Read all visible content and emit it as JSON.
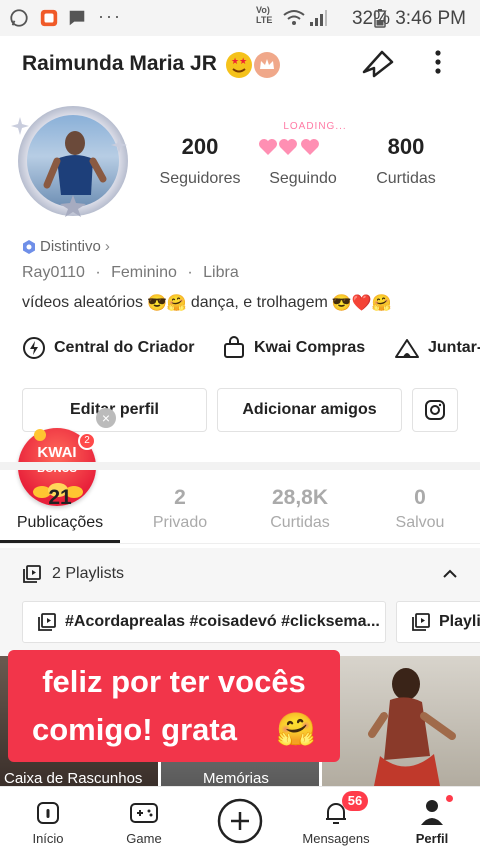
{
  "status_bar": {
    "battery": "32%",
    "time": "3:46 PM",
    "network": "Vo) LTE"
  },
  "header": {
    "name": "Raimunda Maria JR"
  },
  "stats": [
    {
      "value": "200",
      "label": "Seguidores"
    },
    {
      "value": "",
      "label": "Seguindo",
      "overlay": "LOADING..."
    },
    {
      "value": "800",
      "label": "Curtidas"
    }
  ],
  "profile": {
    "badge": "Distintivo",
    "meta": [
      "Ray0110",
      "Feminino",
      "Libra"
    ],
    "bio_a": "vídeos aleatórios",
    "bio_b": "dança, e trolhagem"
  },
  "shortcuts": [
    {
      "label": "Central do Criador",
      "icon": "lightning-icon"
    },
    {
      "label": "Kwai Compras",
      "icon": "shopping-bag-icon"
    },
    {
      "label": "Juntar-",
      "icon": "tent-icon"
    }
  ],
  "buttons": {
    "edit": "Editar perfil",
    "add_friends": "Adicionar amigos"
  },
  "kwai_bonus": {
    "title": "KWAI",
    "subtitle": "BÔNUS",
    "count": "2"
  },
  "tabs": [
    {
      "value": "21",
      "label": "Publicações"
    },
    {
      "value": "2",
      "label": "Privado"
    },
    {
      "value": "28,8K",
      "label": "Curtidas"
    },
    {
      "value": "0",
      "label": "Salvou"
    }
  ],
  "playlists": {
    "title": "2 Playlists",
    "chips": [
      "#Acordaprealas #coisadevó #clicksema...",
      "Playlis"
    ]
  },
  "grid": {
    "overlay_line1": "feliz por ter vocês",
    "overlay_line2": "comigo! grata",
    "cells": [
      "Caixa de Rascunhos",
      "Memórias"
    ]
  },
  "bottom_nav": [
    {
      "label": "Início",
      "icon": "home-icon"
    },
    {
      "label": "Game",
      "icon": "gamepad-icon"
    },
    {
      "label": "",
      "icon": "plus-icon"
    },
    {
      "label": "Mensagens",
      "icon": "bell-icon",
      "badge": "56"
    },
    {
      "label": "Perfil",
      "icon": "person-icon"
    }
  ],
  "colors": {
    "accent": "#ff4a4a",
    "text": "#222222",
    "muted": "#777777",
    "badge_blue": "#4a6ee0"
  }
}
